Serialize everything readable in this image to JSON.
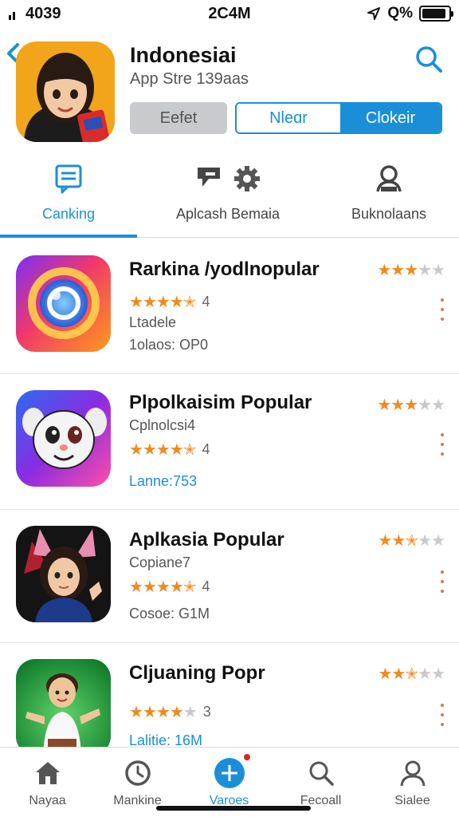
{
  "status_bar": {
    "left_text": "4039",
    "time": "2C4M",
    "right_text": "Q%",
    "battery_level": 0.9
  },
  "header": {
    "title": "Indonesiai",
    "subtitle": "App Stre 139aas",
    "button_gray": "Eefet",
    "segment_a": "Nleɑr",
    "segment_b": "Clokeir"
  },
  "tabs": [
    {
      "label": "Canking",
      "icon": "document-icon",
      "active": true
    },
    {
      "label": "Aplcash Bemaia",
      "icon": "gear-icon",
      "active": false
    },
    {
      "label": "Buknolaans",
      "icon": "user-icon",
      "active": false
    }
  ],
  "apps": [
    {
      "title": "Rarkina /yodlnopular",
      "subtitle": "Ltadele",
      "rating_value": "4",
      "rating_stars": 4.5,
      "top_stars": 3,
      "meta": "1olaos: OP0",
      "meta_blue": false,
      "icon": "camera-lens-icon"
    },
    {
      "title": "Plpolkaisim Popular",
      "subtitle": "Cplnolcsi4",
      "rating_value": "4",
      "rating_stars": 4.5,
      "top_stars": 3,
      "meta": "Lanne:753",
      "meta_blue": true,
      "icon": "cartoon-cat-icon"
    },
    {
      "title": "Aplkasia Popular",
      "subtitle": "Copiane7",
      "rating_value": "4",
      "rating_stars": 4.5,
      "top_stars": 2.5,
      "meta": "Cosoe: G1M",
      "meta_blue": false,
      "icon": "anime-girl-icon"
    },
    {
      "title": "Cljuaning Popr",
      "subtitle": "",
      "rating_value": "3",
      "rating_stars": 4,
      "top_stars": 2.5,
      "meta": "Lalitie: 16M",
      "meta_blue": true,
      "icon": "cartoon-boy-icon"
    }
  ],
  "bottom_nav": [
    {
      "label": "Nayaa",
      "icon": "home-icon",
      "active": false
    },
    {
      "label": "Mankine",
      "icon": "clock-icon",
      "active": false
    },
    {
      "label": "Varoes",
      "icon": "plus-icon",
      "active": true,
      "badge": true
    },
    {
      "label": "Fecoall",
      "icon": "search-icon",
      "active": false
    },
    {
      "label": "Sialee",
      "icon": "user-icon",
      "active": false
    }
  ],
  "colors": {
    "accent": "#1a8fd8",
    "star": "#f08a1c",
    "badge": "#e02424"
  }
}
